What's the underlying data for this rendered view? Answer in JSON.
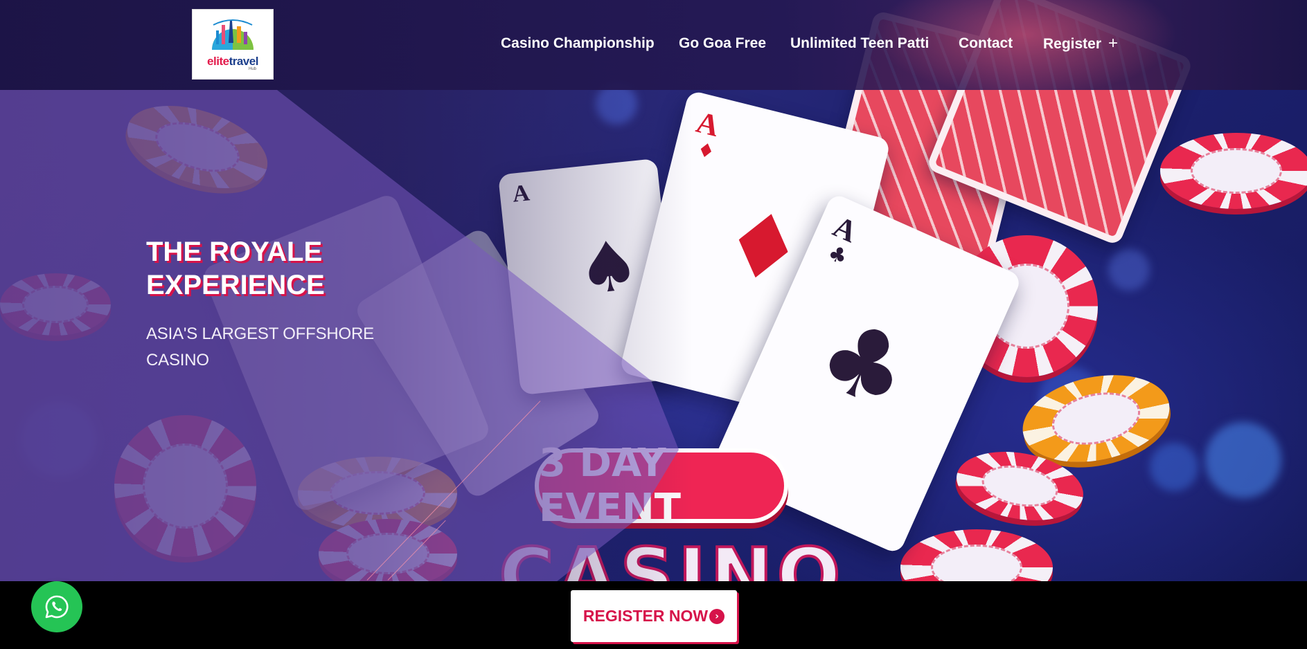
{
  "logo": {
    "brand_part1": "elite",
    "brand_part2": "travel",
    "brand_suffix": "Hub"
  },
  "nav": {
    "items": [
      {
        "label": "Casino Championship"
      },
      {
        "label": "Go Goa Free"
      },
      {
        "label": "Unlimited Teen Patti"
      },
      {
        "label": "Contact"
      },
      {
        "label": "Register",
        "icon": "plus-icon"
      }
    ]
  },
  "hero": {
    "title_line1": "THE ROYALE",
    "title_line2": "EXPERIENCE",
    "subtitle_line1": "ASIA'S LARGEST OFFSHORE",
    "subtitle_line2": "CASINO",
    "banner_event": "3 DAY EVENT",
    "banner_word": "CASINO",
    "card_ace": "A"
  },
  "cta": {
    "label": "REGISTER NOW",
    "icon": "chevron-circle-right-icon"
  },
  "whatsapp": {
    "icon": "whatsapp-icon"
  },
  "colors": {
    "accent": "#d6134a",
    "whatsapp": "#25c455",
    "header_bg": "#1c1446",
    "bottom_bar": "#000000"
  }
}
